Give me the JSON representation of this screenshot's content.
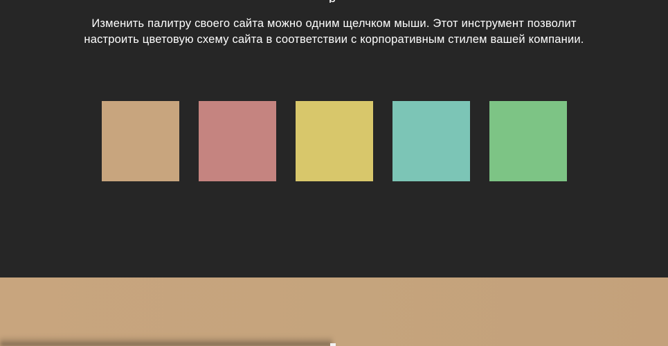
{
  "header": {
    "title_fragment": "р"
  },
  "intro": {
    "line1": "Изменить палитру своего сайта можно одним щелчком мыши. Этот инструмент позволит",
    "line2": "настроить цветовую схему сайта в соответствии с корпоративным стилем вашей компании."
  },
  "palette": {
    "selected_color": "#c8a57e",
    "swatches": [
      {
        "color": "#c8a57e"
      },
      {
        "color": "#c58480"
      },
      {
        "color": "#d8c76b"
      },
      {
        "color": "#7cc5b6"
      },
      {
        "color": "#7dc485"
      }
    ]
  },
  "colors": {
    "page_background": "#262626",
    "text": "#ffffff"
  }
}
